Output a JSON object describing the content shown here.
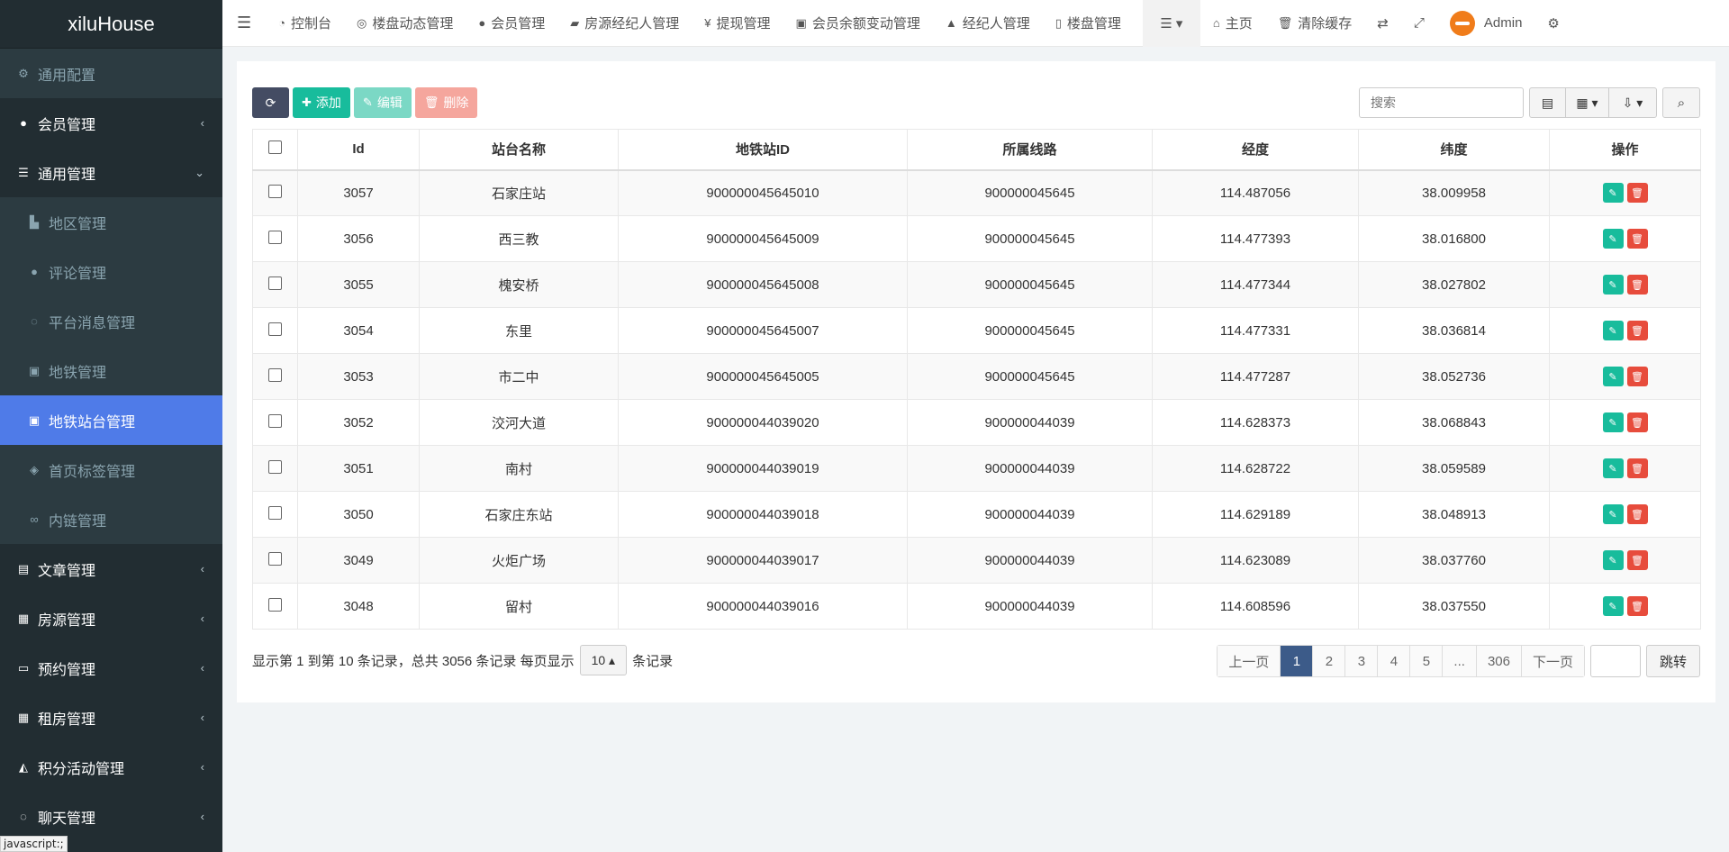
{
  "app": {
    "logo": "xiluHouse"
  },
  "sidebar": {
    "items": [
      {
        "label": "通用配置",
        "icon": "gear-icon",
        "glyph": "⚙",
        "level": "sub0",
        "caret": ""
      },
      {
        "label": "会员管理",
        "icon": "user-circle-icon",
        "glyph": "●",
        "level": "top",
        "caret": "‹"
      },
      {
        "label": "通用管理",
        "icon": "list-icon",
        "glyph": "☰",
        "level": "top",
        "caret": "⌄"
      },
      {
        "label": "地区管理",
        "icon": "area-chart-icon",
        "glyph": "▙",
        "level": "sub",
        "caret": ""
      },
      {
        "label": "评论管理",
        "icon": "comment-icon",
        "glyph": "●",
        "level": "sub",
        "caret": ""
      },
      {
        "label": "平台消息管理",
        "icon": "comments-icon",
        "glyph": "◌",
        "level": "sub",
        "caret": ""
      },
      {
        "label": "地铁管理",
        "icon": "subway-icon",
        "glyph": "▣",
        "level": "sub",
        "caret": ""
      },
      {
        "label": "地铁站台管理",
        "icon": "station-icon",
        "glyph": "▣",
        "level": "active",
        "caret": ""
      },
      {
        "label": "首页标签管理",
        "icon": "tags-icon",
        "glyph": "◈",
        "level": "sub",
        "caret": ""
      },
      {
        "label": "内链管理",
        "icon": "link-icon",
        "glyph": "∞",
        "level": "sub",
        "caret": ""
      },
      {
        "label": "文章管理",
        "icon": "file-icon",
        "glyph": "▤",
        "level": "top",
        "caret": "‹"
      },
      {
        "label": "房源管理",
        "icon": "building-icon",
        "glyph": "▦",
        "level": "top",
        "caret": "‹"
      },
      {
        "label": "预约管理",
        "icon": "laptop-icon",
        "glyph": "▭",
        "level": "top",
        "caret": "‹"
      },
      {
        "label": "租房管理",
        "icon": "building-icon",
        "glyph": "▦",
        "level": "top",
        "caret": "‹"
      },
      {
        "label": "积分活动管理",
        "icon": "bullhorn-icon",
        "glyph": "◭",
        "level": "top",
        "caret": "‹"
      },
      {
        "label": "聊天管理",
        "icon": "chat-icon",
        "glyph": "◌",
        "level": "top",
        "caret": "‹"
      }
    ],
    "status_tip": "javascript:;"
  },
  "topnav": {
    "items": [
      {
        "label": "控制台",
        "icon": "dashboard-icon",
        "glyph": "◔"
      },
      {
        "label": "楼盘动态管理",
        "icon": "tripadvisor-icon",
        "glyph": "◎"
      },
      {
        "label": "会员管理",
        "icon": "user-icon",
        "glyph": "●"
      },
      {
        "label": "房源经纪人管理",
        "icon": "briefcase-icon",
        "glyph": "▰"
      },
      {
        "label": "提现管理",
        "icon": "yen-icon",
        "glyph": "¥"
      },
      {
        "label": "会员余额变动管理",
        "icon": "money-icon",
        "glyph": "▣"
      },
      {
        "label": "经纪人管理",
        "icon": "user-secret-icon",
        "glyph": "▲"
      },
      {
        "label": "楼盘管理",
        "icon": "building-icon",
        "glyph": "▯"
      }
    ],
    "more_glyph": "☰ ▾",
    "home": "主页",
    "clear_cache": "清除缓存",
    "user": "Admin"
  },
  "toolbar": {
    "add": "添加",
    "edit": "编辑",
    "delete": "删除",
    "search_placeholder": "搜索"
  },
  "table": {
    "columns": [
      "Id",
      "站台名称",
      "地铁站ID",
      "所属线路",
      "经度",
      "纬度",
      "操作"
    ],
    "rows": [
      {
        "id": "3057",
        "name": "石家庄站",
        "station_id": "900000045645010",
        "line": "900000045645",
        "lng": "114.487056",
        "lat": "38.009958"
      },
      {
        "id": "3056",
        "name": "西三教",
        "station_id": "900000045645009",
        "line": "900000045645",
        "lng": "114.477393",
        "lat": "38.016800"
      },
      {
        "id": "3055",
        "name": "槐安桥",
        "station_id": "900000045645008",
        "line": "900000045645",
        "lng": "114.477344",
        "lat": "38.027802"
      },
      {
        "id": "3054",
        "name": "东里",
        "station_id": "900000045645007",
        "line": "900000045645",
        "lng": "114.477331",
        "lat": "38.036814"
      },
      {
        "id": "3053",
        "name": "市二中",
        "station_id": "900000045645005",
        "line": "900000045645",
        "lng": "114.477287",
        "lat": "38.052736"
      },
      {
        "id": "3052",
        "name": "洨河大道",
        "station_id": "900000044039020",
        "line": "900000044039",
        "lng": "114.628373",
        "lat": "38.068843"
      },
      {
        "id": "3051",
        "name": "南村",
        "station_id": "900000044039019",
        "line": "900000044039",
        "lng": "114.628722",
        "lat": "38.059589"
      },
      {
        "id": "3050",
        "name": "石家庄东站",
        "station_id": "900000044039018",
        "line": "900000044039",
        "lng": "114.629189",
        "lat": "38.048913"
      },
      {
        "id": "3049",
        "name": "火炬广场",
        "station_id": "900000044039017",
        "line": "900000044039",
        "lng": "114.623089",
        "lat": "38.037760"
      },
      {
        "id": "3048",
        "name": "留村",
        "station_id": "900000044039016",
        "line": "900000044039",
        "lng": "114.608596",
        "lat": "38.037550"
      }
    ]
  },
  "footer": {
    "summary": "显示第 1 到第 10 条记录，总共 3056 条记录 每页显示",
    "page_size": "10",
    "suffix": "条记录",
    "pages": [
      "上一页",
      "1",
      "2",
      "3",
      "4",
      "5",
      "...",
      "306",
      "下一页"
    ],
    "active_page": "1",
    "jump": "跳转"
  }
}
